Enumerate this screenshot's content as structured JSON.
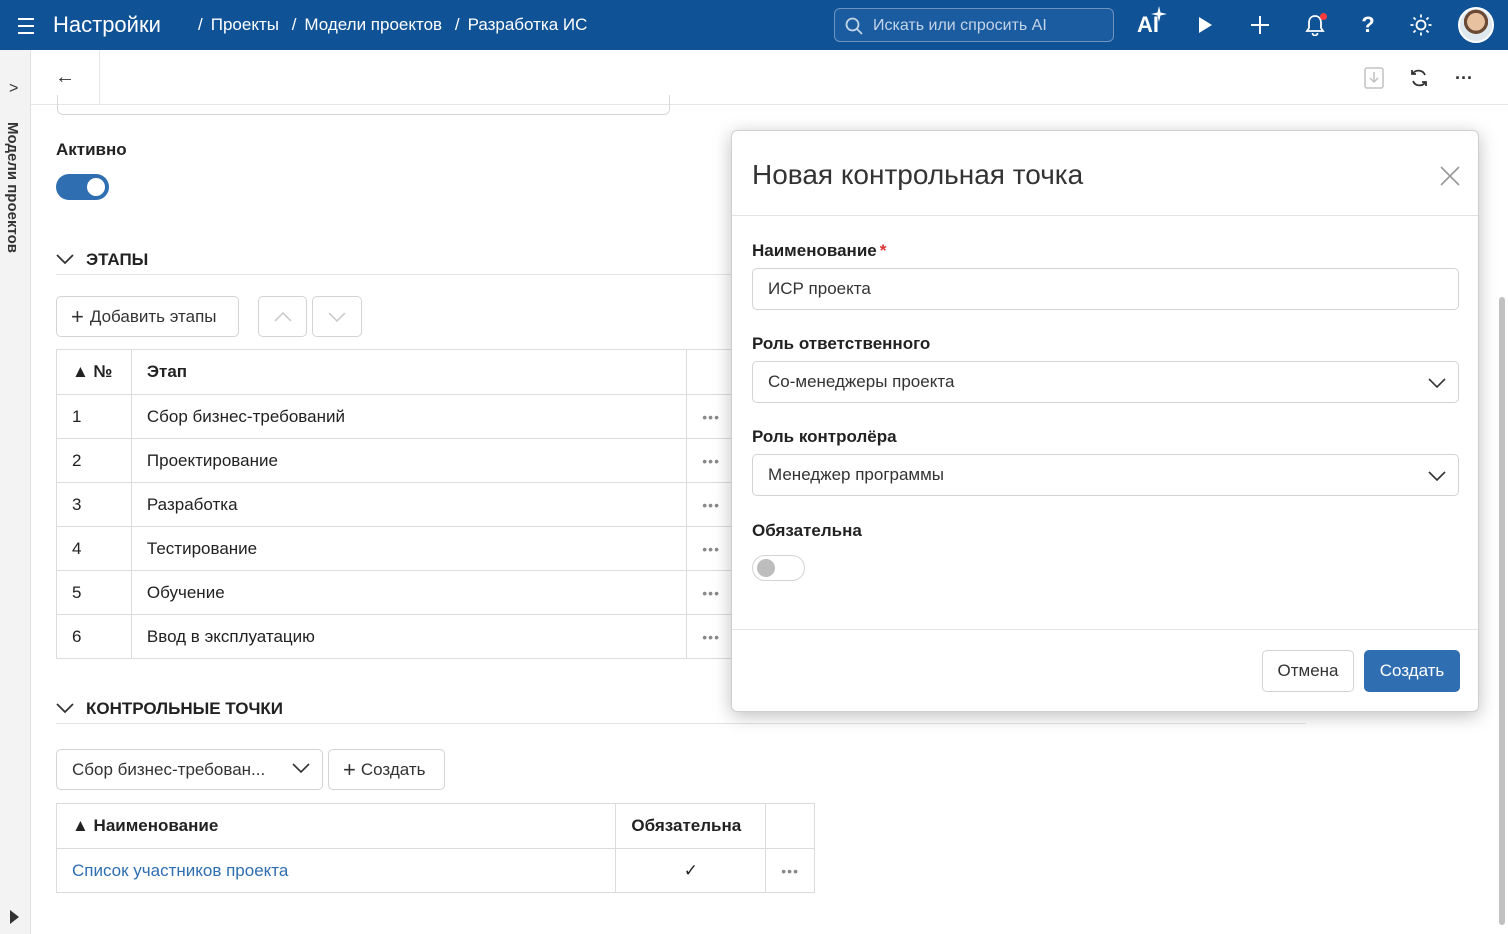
{
  "topbar": {
    "app_title": "Настройки",
    "breadcrumbs": [
      "Проекты",
      "Модели проектов",
      "Разработка ИС"
    ],
    "search_placeholder": "Искать или спросить AI",
    "ai_label": "AI"
  },
  "rail": {
    "vertical_label": "Модели проектов"
  },
  "form": {
    "active_label": "Активно",
    "active": true
  },
  "stages": {
    "section_title": "ЭТАПЫ",
    "add_button": "Добавить этапы",
    "columns": [
      "▲ №",
      "Этап"
    ],
    "rows": [
      {
        "num": "1",
        "name": "Сбор бизнес-требований"
      },
      {
        "num": "2",
        "name": "Проектирование"
      },
      {
        "num": "3",
        "name": "Разработка"
      },
      {
        "num": "4",
        "name": "Тестирование"
      },
      {
        "num": "5",
        "name": "Обучение"
      },
      {
        "num": "6",
        "name": "Ввод в эксплуатацию"
      }
    ]
  },
  "checkpoints": {
    "section_title": "КОНТРОЛЬНЫЕ ТОЧКИ",
    "stage_filter": "Сбор бизнес-требован...",
    "create_button": "Создать",
    "columns": [
      "▲ Наименование",
      "Обязательна"
    ],
    "rows": [
      {
        "name": "Список участников проекта",
        "required": "✓"
      }
    ]
  },
  "dialog": {
    "title": "Новая контрольная точка",
    "name_label": "Наименование",
    "name_value": "ИСР проекта",
    "responsible_label": "Роль ответственного",
    "responsible_value": "Со-менеджеры проекта",
    "controller_label": "Роль контролёра",
    "controller_value": "Менеджер программы",
    "required_label": "Обязательна",
    "required": false,
    "cancel_button": "Отмена",
    "create_button": "Создать"
  },
  "colors": {
    "topbar": "#0f5296",
    "accent": "#2f6eb0",
    "required_marker": "#d33333"
  }
}
